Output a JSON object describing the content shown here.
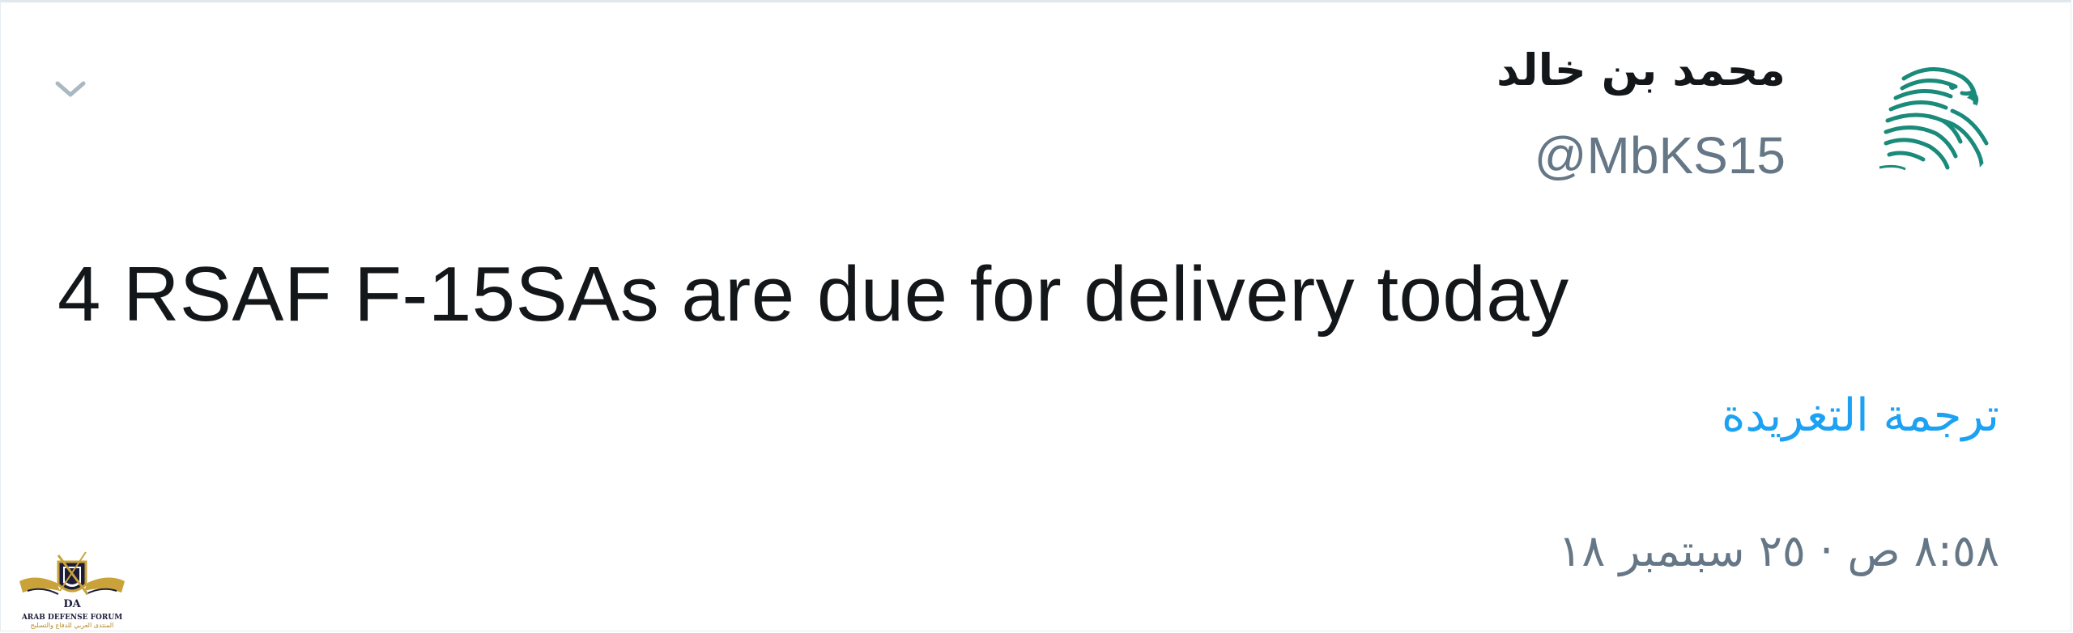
{
  "tweet": {
    "author": {
      "display_name": "محمد بن خالد",
      "handle": "@MbKS15",
      "avatar_icon": "eagle-avatar-icon"
    },
    "text": "4 RSAF F-15SAs are due for delivery today",
    "translate_label": "ترجمة التغريدة",
    "timestamp": "٨:٥٨ ص · ٢٥ سبتمبر ١٨",
    "menu_icon": "chevron-down-icon"
  },
  "watermark": {
    "line1": "ARAB DEFENSE FORUM",
    "line2": "المنتدى العربي للدفاع والتسليح"
  },
  "colors": {
    "text_primary": "#14171a",
    "text_secondary": "#657786",
    "link_blue": "#1da1f2",
    "eagle_teal": "#1a8a7a",
    "border": "#e6ecf0"
  }
}
